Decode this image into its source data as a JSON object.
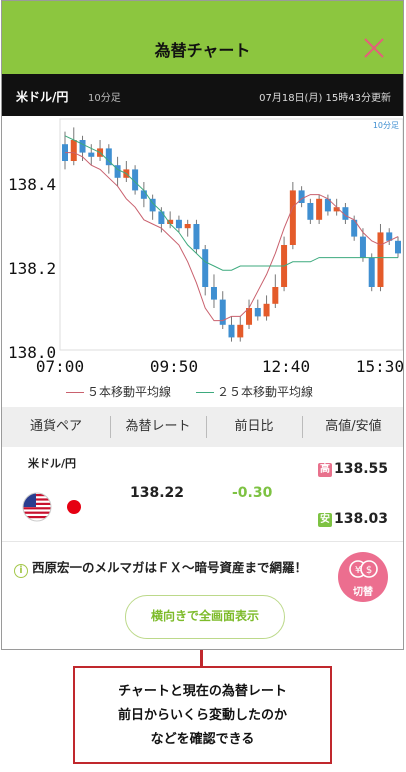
{
  "header": {
    "title": "為替チャート",
    "close_icon": "close-icon"
  },
  "infobar": {
    "pair": "米ドル/円",
    "interval": "10分足",
    "updated": "07月18日(月) 15時43分更新"
  },
  "chart_data": {
    "type": "candlestick",
    "interval_badge": "10分足",
    "x_tick_labels": [
      "07:00",
      "09:50",
      "12:40",
      "15:30"
    ],
    "y_tick_labels": [
      "138.0",
      "138.2",
      "138.4"
    ],
    "ylim": [
      138.0,
      138.55
    ],
    "colors": {
      "up": "#e45b2a",
      "down": "#3f8fd1",
      "ma5": "#c9616e",
      "ma25": "#3daa7e"
    },
    "series": [
      {
        "name": "５本移動平均線",
        "values": [
          138.47,
          138.47,
          138.46,
          138.44,
          138.43,
          138.41,
          138.39,
          138.36,
          138.34,
          138.31,
          138.3,
          138.29,
          138.27,
          138.25,
          138.21,
          138.16,
          138.1,
          138.07,
          138.07,
          138.08,
          138.08,
          138.1,
          138.14,
          138.18,
          138.23,
          138.29,
          138.34,
          138.36,
          138.37,
          138.37,
          138.36,
          138.34,
          138.32,
          138.31,
          138.28,
          138.26,
          138.25,
          138.26,
          138.27
        ]
      },
      {
        "name": "２５本移動平均線",
        "values": [
          138.51,
          138.5,
          138.49,
          138.48,
          138.47,
          138.45,
          138.43,
          138.42,
          138.4,
          138.38,
          138.35,
          138.33,
          138.3,
          138.28,
          138.25,
          138.23,
          138.21,
          138.2,
          138.19,
          138.19,
          138.2,
          138.2,
          138.2,
          138.2,
          138.2,
          138.2,
          138.21,
          138.21,
          138.21,
          138.22,
          138.22,
          138.22,
          138.22,
          138.22,
          138.22,
          138.22,
          138.22,
          138.22,
          138.22
        ]
      }
    ],
    "candles": [
      [
        138.49,
        138.45,
        138.52,
        138.43
      ],
      [
        138.45,
        138.5,
        138.53,
        138.44
      ],
      [
        138.5,
        138.47,
        138.51,
        138.45
      ],
      [
        138.47,
        138.46,
        138.49,
        138.44
      ],
      [
        138.46,
        138.48,
        138.5,
        138.45
      ],
      [
        138.48,
        138.44,
        138.49,
        138.42
      ],
      [
        138.44,
        138.41,
        138.46,
        138.39
      ],
      [
        138.41,
        138.43,
        138.45,
        138.4
      ],
      [
        138.43,
        138.38,
        138.44,
        138.37
      ],
      [
        138.38,
        138.36,
        138.4,
        138.34
      ],
      [
        138.36,
        138.33,
        138.37,
        138.31
      ],
      [
        138.33,
        138.3,
        138.34,
        138.28
      ],
      [
        138.3,
        138.31,
        138.33,
        138.29
      ],
      [
        138.31,
        138.29,
        138.32,
        138.28
      ],
      [
        138.29,
        138.3,
        138.31,
        138.27
      ],
      [
        138.3,
        138.24,
        138.31,
        138.23
      ],
      [
        138.24,
        138.15,
        138.25,
        138.13
      ],
      [
        138.15,
        138.12,
        138.18,
        138.1
      ],
      [
        138.12,
        138.06,
        138.14,
        138.05
      ],
      [
        138.06,
        138.03,
        138.08,
        138.02
      ],
      [
        138.03,
        138.06,
        138.08,
        138.02
      ],
      [
        138.06,
        138.1,
        138.12,
        138.05
      ],
      [
        138.1,
        138.08,
        138.12,
        138.07
      ],
      [
        138.08,
        138.11,
        138.13,
        138.07
      ],
      [
        138.11,
        138.15,
        138.18,
        138.1
      ],
      [
        138.15,
        138.25,
        138.27,
        138.14
      ],
      [
        138.25,
        138.38,
        138.4,
        138.24
      ],
      [
        138.38,
        138.35,
        138.39,
        138.34
      ],
      [
        138.35,
        138.31,
        138.36,
        138.3
      ],
      [
        138.31,
        138.36,
        138.37,
        138.3
      ],
      [
        138.36,
        138.33,
        138.37,
        138.32
      ],
      [
        138.33,
        138.34,
        138.36,
        138.32
      ],
      [
        138.34,
        138.31,
        138.35,
        138.3
      ],
      [
        138.31,
        138.27,
        138.32,
        138.26
      ],
      [
        138.27,
        138.22,
        138.29,
        138.21
      ],
      [
        138.22,
        138.15,
        138.23,
        138.14
      ],
      [
        138.15,
        138.28,
        138.3,
        138.14
      ],
      [
        138.28,
        138.26,
        138.29,
        138.25
      ],
      [
        138.26,
        138.23,
        138.27,
        138.22
      ]
    ]
  },
  "legend": {
    "ma5": "５本移動平均線",
    "ma25": "２５本移動平均線"
  },
  "table": {
    "headers": [
      "通貨ペア",
      "為替レート",
      "前日比",
      "高値/安値"
    ],
    "row": {
      "pair": "米ドル/円",
      "rate": "138.22",
      "change": "-0.30",
      "high_tag": "高",
      "high": "138.55",
      "low_tag": "安",
      "low": "138.03",
      "flags": [
        "us-flag-icon",
        "jp-flag-icon"
      ]
    }
  },
  "notice": {
    "text": "西原宏一のメルマガはＦＸ〜暗号資産まで網羅！"
  },
  "switch_button": {
    "label": "切替",
    "icon": "currency-switch-icon"
  },
  "full_button": {
    "label": "横向きで全画面表示"
  },
  "callout": {
    "lines": [
      "チャートと現在の為替レート",
      "前日からいくら変動したのか",
      "などを確認できる"
    ]
  }
}
